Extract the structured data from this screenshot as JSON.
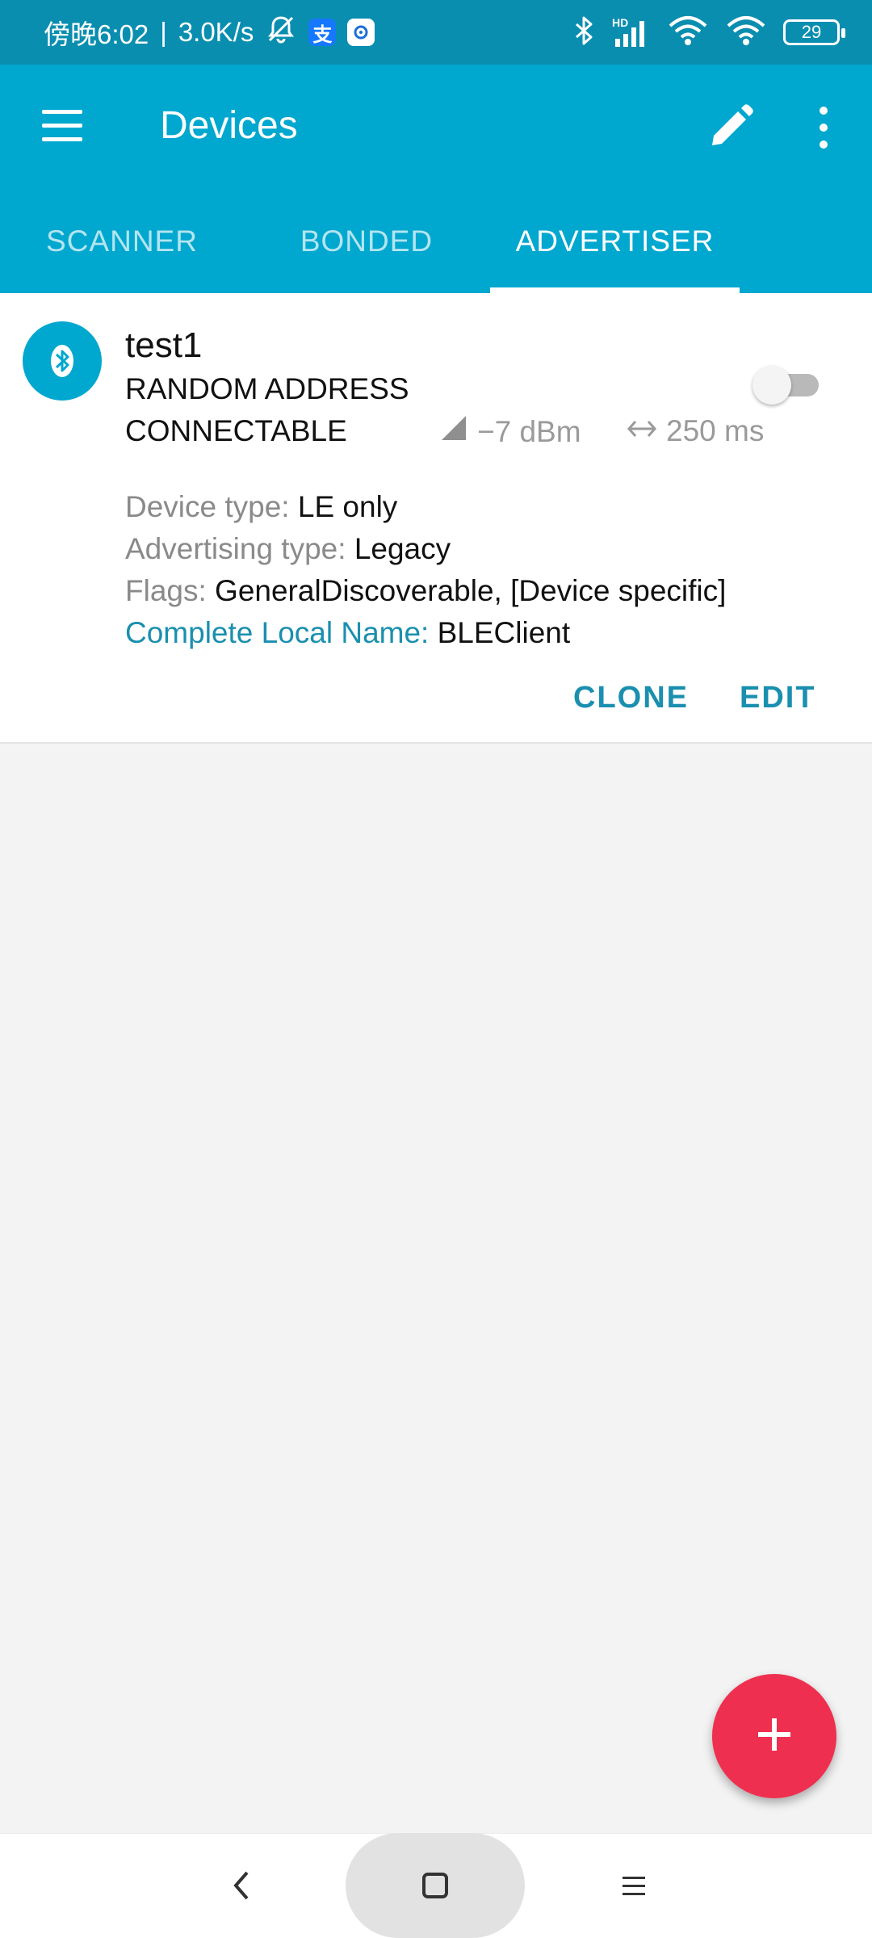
{
  "status_bar": {
    "time": "傍晚6:02",
    "separator": "|",
    "speed": "3.0K/s",
    "app_chip_1": "支",
    "hd_label": "HD",
    "battery": "29",
    "icons": [
      "mute-icon",
      "alipay-icon",
      "app-icon",
      "bluetooth-icon",
      "signal-icon",
      "wifi-icon",
      "wifi-icon",
      "battery-icon"
    ]
  },
  "toolbar": {
    "title": "Devices",
    "icons": [
      "menu-icon",
      "pencil-icon",
      "more-vert-icon"
    ]
  },
  "tabs": [
    {
      "label": "SCANNER",
      "active": false
    },
    {
      "label": "BONDED",
      "active": false
    },
    {
      "label": "ADVERTISER",
      "active": true
    }
  ],
  "advertiser": {
    "name": "test1",
    "address_type": "RANDOM ADDRESS",
    "connectable": "CONNECTABLE",
    "enabled": false,
    "tx_power": "−7 dBm",
    "interval": "250 ms",
    "device_type_label": "Device type:",
    "device_type_value": "LE only",
    "adv_type_label": "Advertising type:",
    "adv_type_value": "Legacy",
    "flags_label": "Flags:",
    "flags_value": "GeneralDiscoverable, [Device specific]",
    "local_name_label": "Complete Local Name:",
    "local_name_value": "BLEClient",
    "clone_label": "CLONE",
    "edit_label": "EDIT"
  },
  "fab": {
    "icon": "plus-icon"
  },
  "nav": {
    "icons": [
      "back-icon",
      "home-icon",
      "recents-icon"
    ]
  },
  "colors": {
    "primary": "#00a7cf",
    "status_bar": "#0a8eb0",
    "accent_text": "#1a8faf",
    "fab": "#ef2f4f"
  }
}
